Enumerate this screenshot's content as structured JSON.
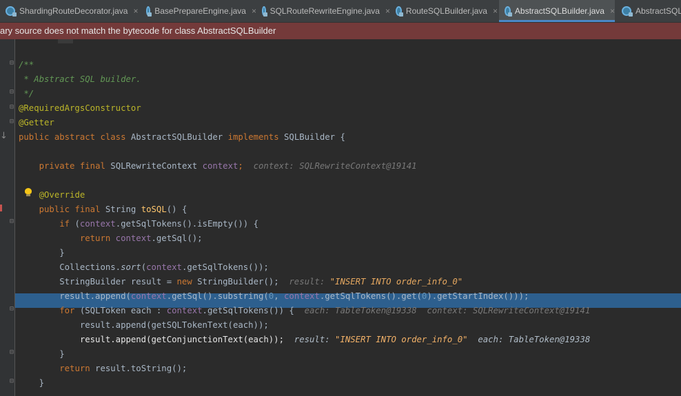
{
  "tabs": [
    {
      "label": "ShardingRouteDecorator.java",
      "active": false
    },
    {
      "label": "BasePrepareEngine.java",
      "active": false
    },
    {
      "label": "SQLRouteRewriteEngine.java",
      "active": false
    },
    {
      "label": "RouteSQLBuilder.java",
      "active": false
    },
    {
      "label": "AbstractSQLBuilder.java",
      "active": true
    },
    {
      "label": "AbstractSQLB",
      "active": false
    }
  ],
  "tab_close_glyph": "×",
  "banner_text": "ary source does not match the bytecode for class AbstractSQLBuilder",
  "code": {
    "l1_open": "/**",
    "l2_doc": " * Abstract SQL builder.",
    "l3_close": " */",
    "l4_ann": "@RequiredArgsConstructor",
    "l5_ann": "@Getter",
    "l6_public": "public",
    "l6_abstract": "abstract",
    "l6_class": "class",
    "l6_name": "AbstractSQLBuilder",
    "l6_implements": "implements",
    "l6_iface": "SQLBuilder {",
    "l7_private": "private",
    "l7_final": "final",
    "l7_type": "SQLRewriteContext",
    "l7_field": "context",
    "l7_semi": ";",
    "l7_hint": "context: SQLRewriteContext@19141",
    "l8_ann": "@Override",
    "l9_public": "public",
    "l9_final": "final",
    "l9_type": "String",
    "l9_method": "toSQL",
    "l9_rest": "() {",
    "l10_if": "if",
    "l10_open": " (",
    "l10_ctx": "context",
    "l10_rest": ".getSqlTokens().isEmpty()) {",
    "l11_return": "return",
    "l11_ctx": "context",
    "l11_rest": ".getSql();",
    "l12": "}",
    "l13_a": "Collections.",
    "l13_sort": "sort",
    "l13_b": "(",
    "l13_ctx": "context",
    "l13_c": ".getSqlTokens());",
    "l14_a": "StringBuilder result = ",
    "l14_new": "new",
    "l14_b": " StringBuilder();",
    "l14_hint_label": "result: ",
    "l14_hint_value": "\"INSERT INTO order_info_0\"",
    "l15_a": "result.append(",
    "l15_ctx1": "context",
    "l15_b": ".getSql().substring(",
    "l15_n0": "0",
    "l15_c": ", ",
    "l15_ctx2": "context",
    "l15_d": ".getSqlTokens().get(",
    "l15_n1": "0",
    "l15_e": ").getStartIndex()));",
    "l16_for": "for",
    "l16_a": " (SQLToken each : ",
    "l16_ctx": "context",
    "l16_b": ".getSqlTokens()) {",
    "l16_hint1": "each: TableToken@19338",
    "l16_hint2": "context: SQLRewriteContext@19141",
    "l17": "result.append(getSQLTokenText(each));",
    "l18": "result.append(getConjunctionText(each));",
    "l18_hint_label": "result: ",
    "l18_hint_value": "\"INSERT INTO order_info_0\"",
    "l18_hint2": "each: TableToken@19338",
    "l19": "}",
    "l20_return": "return",
    "l20_rest": " result.toString();",
    "l21": "}"
  },
  "colors": {
    "background": "#2b2b2b",
    "keyword": "#cc7832",
    "comment": "#629755",
    "annotation": "#bbb529",
    "field": "#9876aa",
    "number": "#6897bb",
    "method_decl": "#ffc66d",
    "execution_line": "#2d5f8e",
    "banner": "#743a3a",
    "active_tab_underline": "#4a88c7"
  },
  "icons": {
    "tab_file_icon": "java-class-file-icon",
    "intention_bulb": "lightbulb-icon",
    "gutter_marker": "override-arrow-icon"
  }
}
